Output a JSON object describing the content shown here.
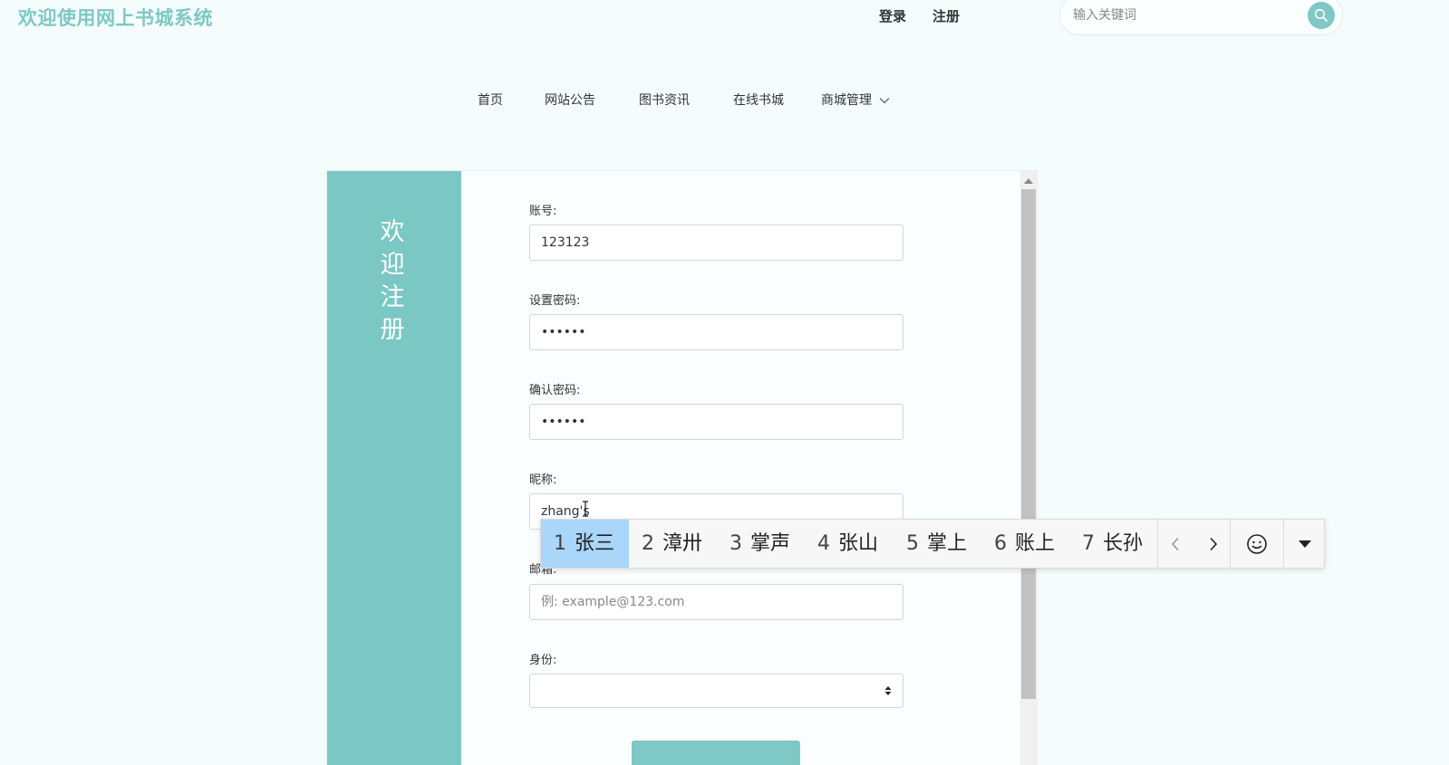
{
  "header": {
    "site_title": "欢迎使用网上书城系统",
    "login_label": "登录",
    "register_label": "注册",
    "search_placeholder": "输入关键词"
  },
  "nav": {
    "items": [
      "首页",
      "网站公告",
      "图书资讯",
      "在线书城",
      "商城管理"
    ]
  },
  "register": {
    "side_title": [
      "欢",
      "迎",
      "注",
      "册"
    ],
    "account_label": "账号:",
    "account_value": "123123",
    "password_label": "设置密码:",
    "password_value": "123456",
    "confirm_label": "确认密码:",
    "confirm_value": "123456",
    "nickname_label": "昵称:",
    "nickname_value": "zhang's",
    "email_label": "邮箱:",
    "email_placeholder": "例: example@123.com",
    "identity_label": "身份:",
    "identity_value": ""
  },
  "ime": {
    "candidates": [
      {
        "num": "1",
        "text": "张三"
      },
      {
        "num": "2",
        "text": "漳卅"
      },
      {
        "num": "3",
        "text": "掌声"
      },
      {
        "num": "4",
        "text": "张山"
      },
      {
        "num": "5",
        "text": "掌上"
      },
      {
        "num": "6",
        "text": "账上"
      },
      {
        "num": "7",
        "text": "长孙"
      }
    ]
  },
  "colors": {
    "accent": "#7ec8c5",
    "side_panel": "#7ac7c4",
    "ime_selected": "#a9d6f9"
  }
}
